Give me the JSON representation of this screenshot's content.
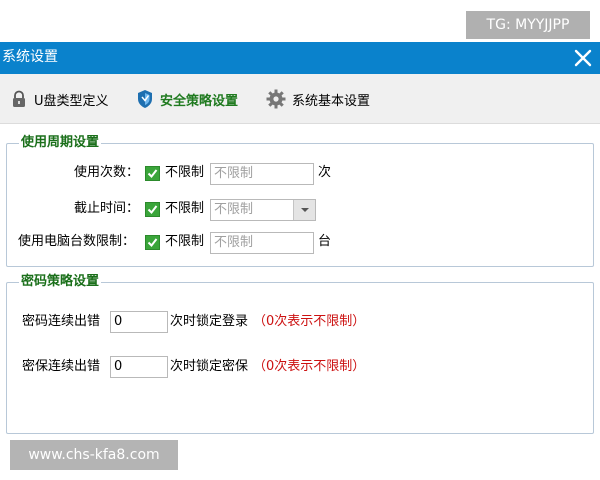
{
  "watermark_top": "TG: MYYJJPP",
  "watermark_bottom": "www.chs-kfa8.com",
  "window": {
    "title": "系统设置"
  },
  "toolbar": {
    "items": [
      {
        "label": "U盘类型定义",
        "icon": "lock-icon"
      },
      {
        "label": "安全策略设置",
        "icon": "shield-icon",
        "active": true
      },
      {
        "label": "系统基本设置",
        "icon": "gear-icon"
      }
    ]
  },
  "usage_period": {
    "title": "使用周期设置",
    "use_count": {
      "label": "使用次数：",
      "checkbox_label": "不限制",
      "value": "不限制",
      "unit": "次"
    },
    "expiry": {
      "label": "截止时间：",
      "checkbox_label": "不限制",
      "value": "不限制"
    },
    "computer_limit": {
      "label": "使用电脑台数限制：",
      "checkbox_label": "不限制",
      "value": "不限制",
      "unit": "台"
    }
  },
  "password_policy": {
    "title": "密码策略设置",
    "login_errors": {
      "label": "密码连续出错",
      "value": "0",
      "suffix": "次时锁定登录",
      "hint": "（0次表示不限制）"
    },
    "protect_errors": {
      "label": "密保连续出错",
      "value": "0",
      "suffix": "次时锁定密保",
      "hint": "（0次表示不限制）"
    }
  },
  "colors": {
    "titlebar": "#0a82cc",
    "accent_green": "#1a6f1a",
    "hint_red": "#cc1111",
    "checkbox": "#3aa53a"
  }
}
